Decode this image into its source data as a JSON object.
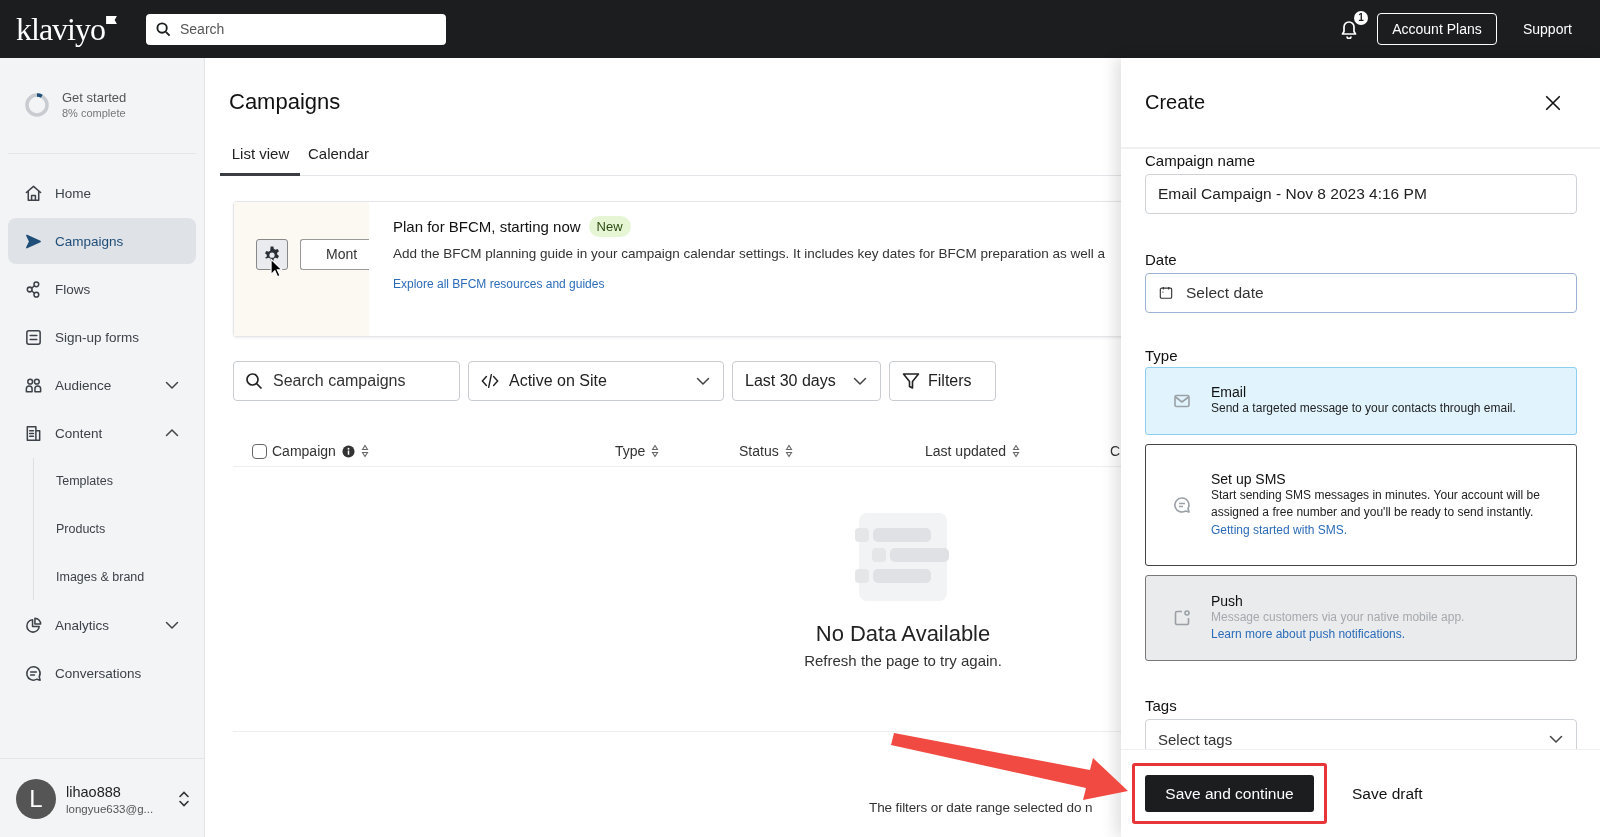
{
  "topbar": {
    "logo": "klaviyo",
    "search": {
      "placeholder": "Search"
    },
    "notifications": {
      "count": "1"
    },
    "buttons": [
      {
        "label": "Account Plans",
        "kind": "outlined"
      },
      {
        "label": "Support",
        "kind": "plain"
      }
    ]
  },
  "sidebar": {
    "progress": {
      "title": "Get started",
      "subtitle": "8% complete",
      "level": 0.08
    },
    "items": [
      {
        "label": "Home",
        "selected": false
      },
      {
        "label": "Campaigns",
        "selected": true
      },
      {
        "label": "Flows",
        "selected": false
      },
      {
        "label": "Sign-up forms",
        "selected": false
      },
      {
        "label": "Audience",
        "selected": false,
        "expanded": false
      },
      {
        "label": "Content",
        "selected": false,
        "expanded": true,
        "children": [
          {
            "label": "Templates",
            "selected": false
          },
          {
            "label": "Products",
            "selected": false
          },
          {
            "label": "Images & brand",
            "selected": false
          }
        ]
      },
      {
        "label": "Analytics",
        "selected": false,
        "expanded": false
      },
      {
        "label": "Conversations",
        "selected": false
      }
    ],
    "user": {
      "initial": "L",
      "name": "lihao888",
      "email": "longyue633@g..."
    }
  },
  "page": {
    "title": "Campaigns",
    "tabs": [
      {
        "label": "List view",
        "selected": true
      },
      {
        "label": "Calendar",
        "selected": false
      }
    ],
    "banner": {
      "button": "Mont",
      "title": "Plan for BFCM, starting now",
      "badge": "New",
      "text": "Add the BFCM planning guide in your campaign calendar settings. It includes key dates for BFCM preparation as well a",
      "link": "Explore all BFCM resources and guides"
    },
    "filters": {
      "search": {
        "placeholder": "Search campaigns"
      },
      "dropdowns": [
        {
          "label": "Active on Site"
        },
        {
          "label": "Last 30 days"
        }
      ],
      "button": "Filters"
    },
    "table": {
      "select_all": {
        "checked": false
      },
      "columns": [
        {
          "label": "Campaign",
          "info": true,
          "sortable": true
        },
        {
          "label": "Type",
          "info": false,
          "sortable": true
        },
        {
          "label": "Status",
          "info": false,
          "sortable": true
        },
        {
          "label": "Last updated",
          "info": false,
          "sortable": true
        },
        {
          "label": "C",
          "info": false,
          "sortable": false
        }
      ]
    },
    "empty": {
      "title": "No Data Available",
      "text": "Refresh the page to try again."
    },
    "footer_note": "The filters or date range selected do n"
  },
  "drawer": {
    "title": "Create",
    "fields": [
      {
        "label": "Campaign name",
        "kind": "text",
        "value": "Email Campaign - Nov 8 2023 4:16 PM"
      },
      {
        "label": "Date",
        "kind": "date",
        "placeholder": "Select date"
      }
    ],
    "type": {
      "label": "Type",
      "options": [
        {
          "title": "Email",
          "description": "Send a targeted message to your contacts through email.",
          "selected": true,
          "disabled": false
        },
        {
          "title": "Set up SMS",
          "description": "Start sending SMS messages in minutes. Your account will be assigned a free number and you'll be ready to send instantly.",
          "link": "Getting started with SMS.",
          "selected": false,
          "disabled": false
        },
        {
          "title": "Push",
          "description": "Message customers via your native mobile app.",
          "link": "Learn more about push notifications.",
          "selected": false,
          "disabled": true
        }
      ]
    },
    "tags": {
      "label": "Tags",
      "placeholder": "Select tags"
    },
    "actions": [
      {
        "label": "Save and continue",
        "kind": "primary",
        "highlighted": true
      },
      {
        "label": "Save draft",
        "kind": "plain",
        "highlighted": false
      }
    ]
  }
}
